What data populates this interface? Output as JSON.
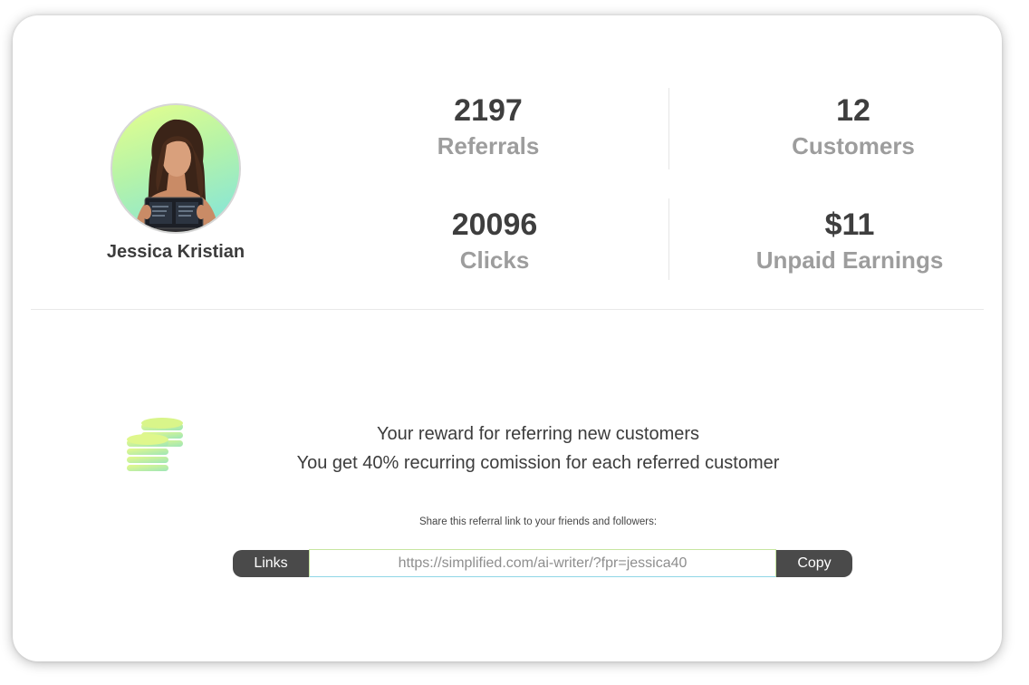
{
  "profile": {
    "name": "Jessica Kristian",
    "avatar_icon": "profile-photo"
  },
  "stats": {
    "referrals": {
      "value": "2197",
      "label": "Referrals"
    },
    "customers": {
      "value": "12",
      "label": "Customers"
    },
    "clicks": {
      "value": "20096",
      "label": "Clicks"
    },
    "unpaid_earnings": {
      "value": "$11",
      "label": "Unpaid Earnings"
    }
  },
  "reward": {
    "icon": "coins-icon",
    "line1": "Your reward for referring new customers",
    "line2": "You get 40% recurring comission for each referred customer"
  },
  "share": {
    "instruction": "Share this referral link to your friends and followers:",
    "links_label": "Links",
    "url": "https://simplified.com/ai-writer/?fpr=jessica40",
    "copy_label": "Copy"
  },
  "colors": {
    "button_bg": "#4a4a4a",
    "value_text": "#3e3e3e",
    "label_text": "#9d9d9d",
    "accent_green": "#c8f58a",
    "accent_cyan": "#7fe3e0"
  }
}
